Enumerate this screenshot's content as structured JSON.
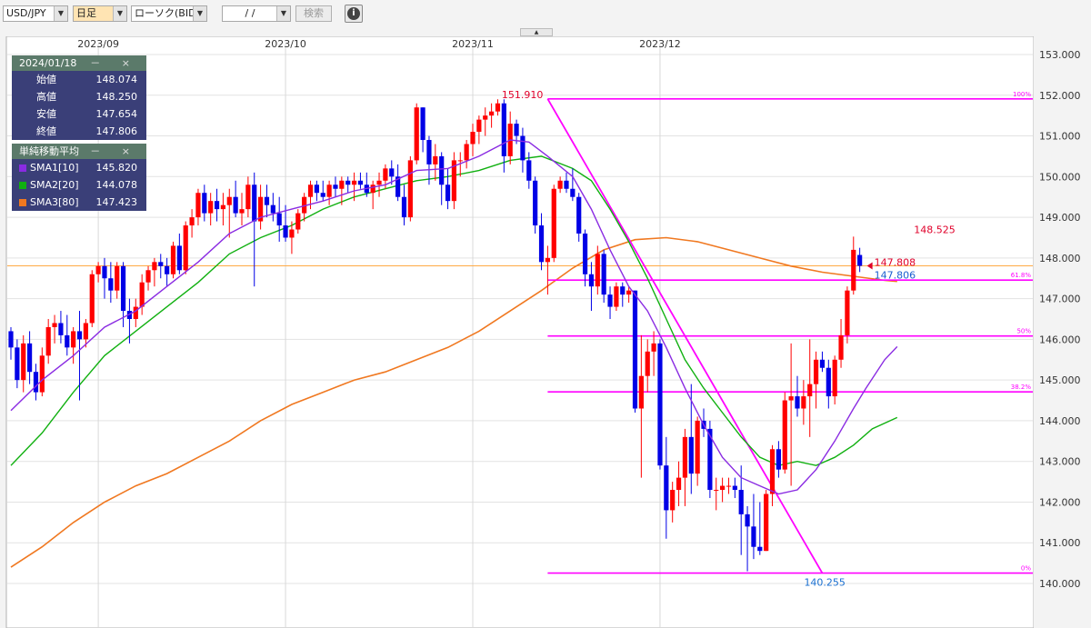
{
  "toolbar": {
    "pair": "USD/JPY",
    "timeframe": "日足",
    "chart_type": "ローソク(BID)",
    "date_value": "/ /",
    "search_label": "検索",
    "info_icon": "info-circle-icon",
    "collapse_icon": "triangle-up-icon"
  },
  "ohlc_panel": {
    "date": "2024/01/18",
    "controls": "－ ×",
    "rows": [
      {
        "label": "始値",
        "value": "148.074"
      },
      {
        "label": "高値",
        "value": "148.250"
      },
      {
        "label": "安値",
        "value": "147.654"
      },
      {
        "label": "終値",
        "value": "147.806"
      }
    ]
  },
  "sma_panel": {
    "title": "単純移動平均",
    "controls": "－ ×",
    "rows": [
      {
        "label": "SMA1[10]",
        "value": "145.820",
        "color": "#8a2be2"
      },
      {
        "label": "SMA2[20]",
        "value": "144.078",
        "color": "#10b010"
      },
      {
        "label": "SMA3[80]",
        "value": "147.423",
        "color": "#f07820"
      }
    ]
  },
  "chart_data": {
    "type": "candlestick",
    "x_ticks": [
      {
        "label": "2023/09",
        "index": 14
      },
      {
        "label": "2023/10",
        "index": 44
      },
      {
        "label": "2023/11",
        "index": 74
      },
      {
        "label": "2023/12",
        "index": 104
      }
    ],
    "y_range": [
      140.0,
      153.0
    ],
    "y_ticks": [
      "153.000",
      "152.000",
      "151.000",
      "150.000",
      "149.000",
      "148.000",
      "147.000",
      "146.000",
      "145.000",
      "144.000",
      "143.000",
      "142.000",
      "141.000",
      "140.000"
    ],
    "grid": true,
    "colors": {
      "up": "#ff0000",
      "down": "#0000e6",
      "fib": "#ff00ff",
      "sma1": "#8a2be2",
      "sma2": "#10b010",
      "sma3": "#f07820",
      "last": "#ffaa44"
    },
    "fibonacci": {
      "high": {
        "value": 151.91,
        "label": "151.910"
      },
      "low": {
        "value": 140.255,
        "label": "140.255"
      },
      "levels": [
        {
          "ratio": "100%",
          "value": 151.91
        },
        {
          "ratio": "61.8%",
          "value": 147.457
        },
        {
          "ratio": "50%",
          "value": 146.083
        },
        {
          "ratio": "38.2%",
          "value": 144.708
        },
        {
          "ratio": "0%",
          "value": 140.255
        }
      ],
      "start_index": 86,
      "low_index": 130
    },
    "annotations": {
      "recent_high": {
        "value": 148.525,
        "label": "148.525"
      },
      "last_close_marker": {
        "value": 147.808,
        "label": "147.808"
      },
      "last_close": {
        "value": 147.806,
        "label": "147.806"
      }
    },
    "candles": [
      [
        146.2,
        146.3,
        145.5,
        145.8
      ],
      [
        145.8,
        146.0,
        144.8,
        145.0
      ],
      [
        145.0,
        146.1,
        144.7,
        145.9
      ],
      [
        145.9,
        146.2,
        144.9,
        145.2
      ],
      [
        145.2,
        145.4,
        144.5,
        144.7
      ],
      [
        144.7,
        145.8,
        144.6,
        145.6
      ],
      [
        145.6,
        146.5,
        145.4,
        146.3
      ],
      [
        146.3,
        146.6,
        145.9,
        146.4
      ],
      [
        146.4,
        146.7,
        145.9,
        146.1
      ],
      [
        146.1,
        146.6,
        145.6,
        145.8
      ],
      [
        145.8,
        146.3,
        145.4,
        146.2
      ],
      [
        146.2,
        146.7,
        144.5,
        146.0
      ],
      [
        146.0,
        146.5,
        145.8,
        146.4
      ],
      [
        146.4,
        147.7,
        146.3,
        147.6
      ],
      [
        147.6,
        147.9,
        147.4,
        147.8
      ],
      [
        147.8,
        148.0,
        147.0,
        147.5
      ],
      [
        147.5,
        147.9,
        146.9,
        147.2
      ],
      [
        147.2,
        147.9,
        147.0,
        147.8
      ],
      [
        147.8,
        147.9,
        146.3,
        146.7
      ],
      [
        146.7,
        147.0,
        145.9,
        146.5
      ],
      [
        146.5,
        147.0,
        146.3,
        146.8
      ],
      [
        146.8,
        147.6,
        146.6,
        147.4
      ],
      [
        147.4,
        147.8,
        147.2,
        147.7
      ],
      [
        147.7,
        148.0,
        147.3,
        147.9
      ],
      [
        147.9,
        148.1,
        147.5,
        147.8
      ],
      [
        147.8,
        148.0,
        147.3,
        147.6
      ],
      [
        147.6,
        148.4,
        147.5,
        148.3
      ],
      [
        148.3,
        148.6,
        147.6,
        147.7
      ],
      [
        147.7,
        148.9,
        147.6,
        148.8
      ],
      [
        148.8,
        149.2,
        148.5,
        149.0
      ],
      [
        149.0,
        149.7,
        148.8,
        149.6
      ],
      [
        149.6,
        149.8,
        148.9,
        149.1
      ],
      [
        149.1,
        149.6,
        148.8,
        149.4
      ],
      [
        149.4,
        149.7,
        148.9,
        149.2
      ],
      [
        149.2,
        149.6,
        148.8,
        149.3
      ],
      [
        149.3,
        149.7,
        148.5,
        149.5
      ],
      [
        149.5,
        149.9,
        149.0,
        149.1
      ],
      [
        149.1,
        149.6,
        148.8,
        149.2
      ],
      [
        149.2,
        150.0,
        149.0,
        149.8
      ],
      [
        149.8,
        150.1,
        147.3,
        148.9
      ],
      [
        148.9,
        149.8,
        148.7,
        149.5
      ],
      [
        149.5,
        149.8,
        149.0,
        149.3
      ],
      [
        149.3,
        149.6,
        148.9,
        149.1
      ],
      [
        149.1,
        149.5,
        148.4,
        148.8
      ],
      [
        148.8,
        149.3,
        148.4,
        148.5
      ],
      [
        148.5,
        148.9,
        148.1,
        148.7
      ],
      [
        148.7,
        149.2,
        148.6,
        149.1
      ],
      [
        149.1,
        149.6,
        148.9,
        149.5
      ],
      [
        149.5,
        149.9,
        149.2,
        149.8
      ],
      [
        149.8,
        149.9,
        149.4,
        149.6
      ],
      [
        149.6,
        149.9,
        149.4,
        149.5
      ],
      [
        149.5,
        149.9,
        149.3,
        149.8
      ],
      [
        149.8,
        150.0,
        149.5,
        149.7
      ],
      [
        149.7,
        150.0,
        149.3,
        149.9
      ],
      [
        149.9,
        150.0,
        149.6,
        149.8
      ],
      [
        149.8,
        150.1,
        149.4,
        149.9
      ],
      [
        149.9,
        150.1,
        149.7,
        149.8
      ],
      [
        149.8,
        150.1,
        149.5,
        149.6
      ],
      [
        149.6,
        149.9,
        149.2,
        149.8
      ],
      [
        149.8,
        150.1,
        149.5,
        149.9
      ],
      [
        149.9,
        150.3,
        149.7,
        150.2
      ],
      [
        150.2,
        150.4,
        149.8,
        150.0
      ],
      [
        150.0,
        150.3,
        149.4,
        149.5
      ],
      [
        149.5,
        149.8,
        148.8,
        149.0
      ],
      [
        149.0,
        150.5,
        148.9,
        150.4
      ],
      [
        150.4,
        151.8,
        150.3,
        151.7
      ],
      [
        151.7,
        151.7,
        150.6,
        150.9
      ],
      [
        150.9,
        151.0,
        149.8,
        150.3
      ],
      [
        150.3,
        150.8,
        149.9,
        150.5
      ],
      [
        150.5,
        150.6,
        149.3,
        149.8
      ],
      [
        149.8,
        150.2,
        149.2,
        149.4
      ],
      [
        149.4,
        150.6,
        149.2,
        150.4
      ],
      [
        150.4,
        150.6,
        150.0,
        150.4
      ],
      [
        150.4,
        150.9,
        150.2,
        150.8
      ],
      [
        150.8,
        151.3,
        150.5,
        151.1
      ],
      [
        151.1,
        151.5,
        150.8,
        151.4
      ],
      [
        151.4,
        151.7,
        151.0,
        151.5
      ],
      [
        151.5,
        151.8,
        151.2,
        151.6
      ],
      [
        151.6,
        151.9,
        151.5,
        151.8
      ],
      [
        151.8,
        151.9,
        150.1,
        150.5
      ],
      [
        150.5,
        151.6,
        150.3,
        151.3
      ],
      [
        151.3,
        151.4,
        150.8,
        151.0
      ],
      [
        151.0,
        151.2,
        150.1,
        150.4
      ],
      [
        150.4,
        150.6,
        149.7,
        149.9
      ],
      [
        149.9,
        150.0,
        148.6,
        148.8
      ],
      [
        148.8,
        149.1,
        147.7,
        147.9
      ],
      [
        147.9,
        148.3,
        147.1,
        148.0
      ],
      [
        148.0,
        149.8,
        147.9,
        149.7
      ],
      [
        149.7,
        150.0,
        149.6,
        149.9
      ],
      [
        149.9,
        150.1,
        149.6,
        149.7
      ],
      [
        149.7,
        150.2,
        149.4,
        149.5
      ],
      [
        149.5,
        149.6,
        148.4,
        148.6
      ],
      [
        148.6,
        148.7,
        147.3,
        147.6
      ],
      [
        147.6,
        147.9,
        146.7,
        147.3
      ],
      [
        147.3,
        148.3,
        147.1,
        148.1
      ],
      [
        148.1,
        148.2,
        146.9,
        147.1
      ],
      [
        147.1,
        147.3,
        146.5,
        146.8
      ],
      [
        146.8,
        147.4,
        146.7,
        147.3
      ],
      [
        147.3,
        147.4,
        146.8,
        147.1
      ],
      [
        147.1,
        147.3,
        146.9,
        147.2
      ],
      [
        147.2,
        147.2,
        144.2,
        144.3
      ],
      [
        144.3,
        146.1,
        142.6,
        145.1
      ],
      [
        145.1,
        146.0,
        144.7,
        145.7
      ],
      [
        145.7,
        146.2,
        145.1,
        145.9
      ],
      [
        145.9,
        146.0,
        142.8,
        142.9
      ],
      [
        142.9,
        143.6,
        141.1,
        141.8
      ],
      [
        141.8,
        142.5,
        141.5,
        142.3
      ],
      [
        142.3,
        143.0,
        141.9,
        142.6
      ],
      [
        142.6,
        143.8,
        141.9,
        143.6
      ],
      [
        143.6,
        144.9,
        142.2,
        142.7
      ],
      [
        142.7,
        144.1,
        142.4,
        144.0
      ],
      [
        144.0,
        144.3,
        143.6,
        143.8
      ],
      [
        143.8,
        144.0,
        142.1,
        142.3
      ],
      [
        142.3,
        142.6,
        141.8,
        142.3
      ],
      [
        142.3,
        142.6,
        142.0,
        142.4
      ],
      [
        142.4,
        142.6,
        142.2,
        142.4
      ],
      [
        142.4,
        142.6,
        142.1,
        142.3
      ],
      [
        142.3,
        142.9,
        140.7,
        141.7
      ],
      [
        141.7,
        141.9,
        140.3,
        141.4
      ],
      [
        141.4,
        142.2,
        140.6,
        140.9
      ],
      [
        140.9,
        142.0,
        140.7,
        140.8
      ],
      [
        140.8,
        142.3,
        140.8,
        142.2
      ],
      [
        142.2,
        143.4,
        141.9,
        143.3
      ],
      [
        143.3,
        143.5,
        142.6,
        142.8
      ],
      [
        142.8,
        144.7,
        142.7,
        144.5
      ],
      [
        144.5,
        145.9,
        142.4,
        144.6
      ],
      [
        144.6,
        145.1,
        144.1,
        144.3
      ],
      [
        144.3,
        145.0,
        143.9,
        144.6
      ],
      [
        144.6,
        146.0,
        143.6,
        144.9
      ],
      [
        144.9,
        145.7,
        144.3,
        145.5
      ],
      [
        145.5,
        145.7,
        145.2,
        145.3
      ],
      [
        145.3,
        145.5,
        144.3,
        144.6
      ],
      [
        144.6,
        145.6,
        144.4,
        145.5
      ],
      [
        145.5,
        146.5,
        145.3,
        146.1
      ],
      [
        146.1,
        147.3,
        145.9,
        147.2
      ],
      [
        147.2,
        148.525,
        147.1,
        148.2
      ],
      [
        148.074,
        148.25,
        147.654,
        147.806
      ]
    ],
    "sma1": [
      [
        0,
        144.25
      ],
      [
        5,
        145.0
      ],
      [
        10,
        145.6
      ],
      [
        15,
        146.3
      ],
      [
        20,
        146.7
      ],
      [
        25,
        147.3
      ],
      [
        30,
        147.9
      ],
      [
        35,
        148.6
      ],
      [
        40,
        149.0
      ],
      [
        45,
        149.2
      ],
      [
        50,
        149.4
      ],
      [
        55,
        149.65
      ],
      [
        60,
        149.8
      ],
      [
        65,
        150.15
      ],
      [
        70,
        150.2
      ],
      [
        75,
        150.5
      ],
      [
        80,
        150.9
      ],
      [
        83,
        150.85
      ],
      [
        86,
        150.5
      ],
      [
        90,
        150.0
      ],
      [
        93,
        149.2
      ],
      [
        96,
        148.2
      ],
      [
        99,
        147.3
      ],
      [
        102,
        146.7
      ],
      [
        105,
        145.8
      ],
      [
        108,
        144.8
      ],
      [
        111,
        143.9
      ],
      [
        114,
        143.1
      ],
      [
        117,
        142.6
      ],
      [
        120,
        142.4
      ],
      [
        123,
        142.2
      ],
      [
        126,
        142.3
      ],
      [
        129,
        142.8
      ],
      [
        132,
        143.5
      ],
      [
        135,
        144.3
      ],
      [
        137,
        144.8
      ],
      [
        140,
        145.5
      ],
      [
        142,
        145.82
      ]
    ],
    "sma2": [
      [
        0,
        142.9
      ],
      [
        5,
        143.7
      ],
      [
        10,
        144.7
      ],
      [
        15,
        145.6
      ],
      [
        20,
        146.2
      ],
      [
        25,
        146.8
      ],
      [
        30,
        147.4
      ],
      [
        35,
        148.1
      ],
      [
        40,
        148.5
      ],
      [
        45,
        148.8
      ],
      [
        50,
        149.2
      ],
      [
        55,
        149.5
      ],
      [
        60,
        149.7
      ],
      [
        65,
        149.9
      ],
      [
        70,
        150.0
      ],
      [
        75,
        150.15
      ],
      [
        80,
        150.4
      ],
      [
        85,
        150.5
      ],
      [
        90,
        150.2
      ],
      [
        93,
        149.9
      ],
      [
        96,
        149.2
      ],
      [
        99,
        148.4
      ],
      [
        102,
        147.5
      ],
      [
        105,
        146.5
      ],
      [
        108,
        145.5
      ],
      [
        111,
        144.8
      ],
      [
        114,
        144.2
      ],
      [
        117,
        143.6
      ],
      [
        120,
        143.1
      ],
      [
        123,
        142.9
      ],
      [
        126,
        143.0
      ],
      [
        129,
        142.9
      ],
      [
        132,
        143.1
      ],
      [
        135,
        143.4
      ],
      [
        138,
        143.8
      ],
      [
        142,
        144.078
      ]
    ],
    "sma3": [
      [
        0,
        140.4
      ],
      [
        5,
        140.9
      ],
      [
        10,
        141.5
      ],
      [
        15,
        142.0
      ],
      [
        20,
        142.4
      ],
      [
        25,
        142.7
      ],
      [
        30,
        143.1
      ],
      [
        35,
        143.5
      ],
      [
        40,
        144.0
      ],
      [
        45,
        144.4
      ],
      [
        50,
        144.7
      ],
      [
        55,
        145.0
      ],
      [
        60,
        145.2
      ],
      [
        65,
        145.5
      ],
      [
        70,
        145.8
      ],
      [
        75,
        146.2
      ],
      [
        80,
        146.7
      ],
      [
        85,
        147.2
      ],
      [
        90,
        147.75
      ],
      [
        95,
        148.2
      ],
      [
        100,
        148.45
      ],
      [
        105,
        148.5
      ],
      [
        110,
        148.4
      ],
      [
        115,
        148.2
      ],
      [
        120,
        148.0
      ],
      [
        125,
        147.8
      ],
      [
        130,
        147.65
      ],
      [
        135,
        147.55
      ],
      [
        140,
        147.45
      ],
      [
        142,
        147.423
      ]
    ]
  }
}
